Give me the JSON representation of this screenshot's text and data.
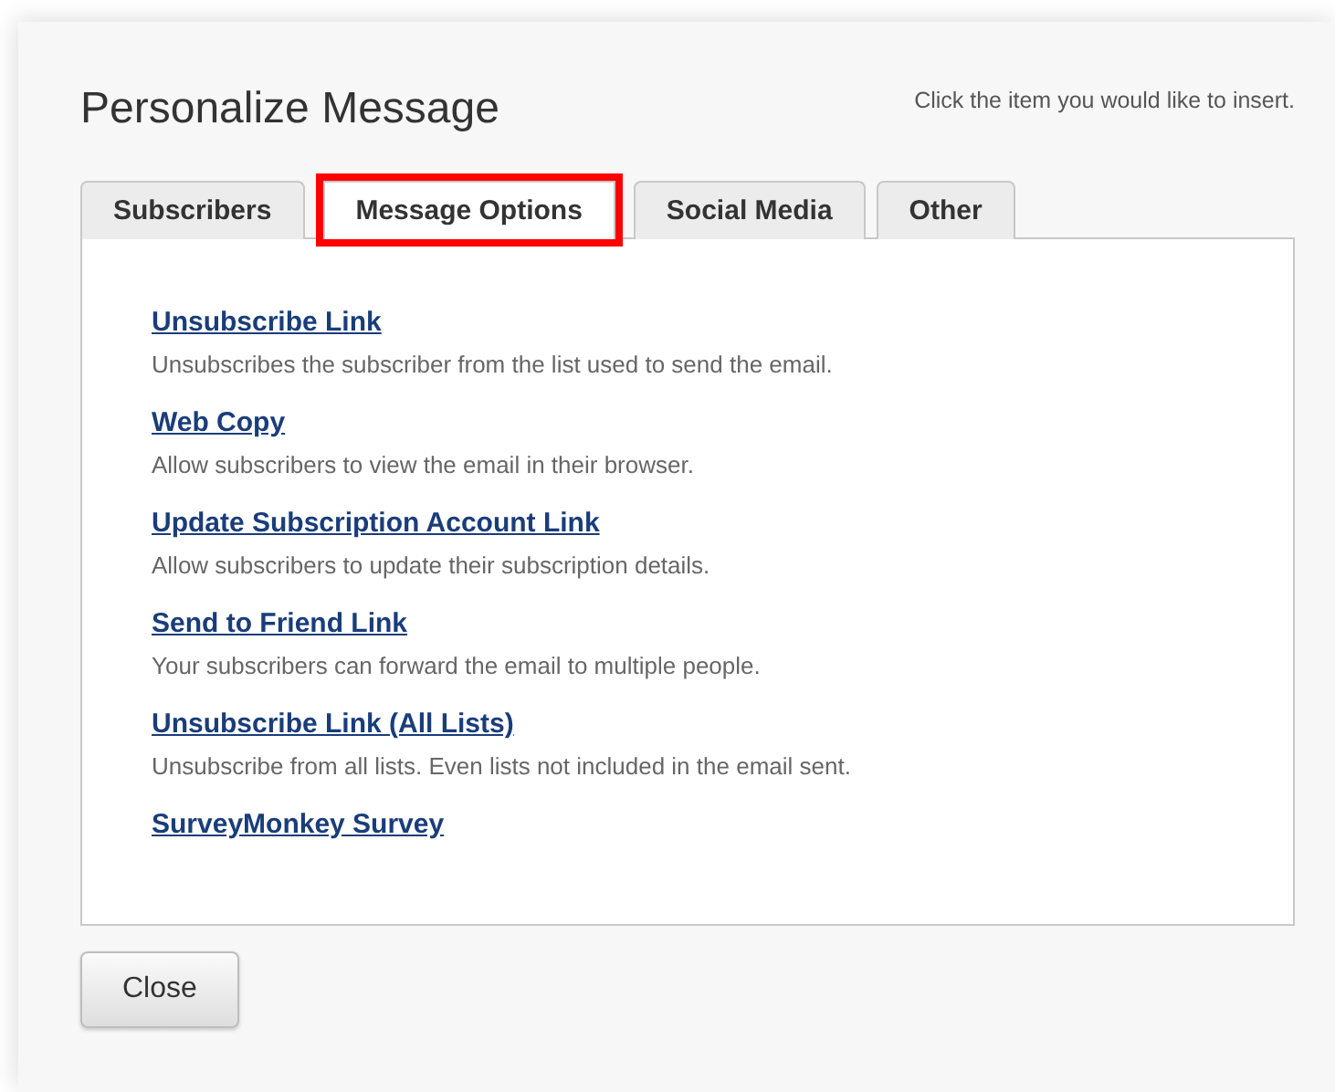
{
  "dialog": {
    "title": "Personalize Message",
    "hint": "Click the item you would like to insert."
  },
  "tabs": [
    {
      "label": "Subscribers",
      "selected": false,
      "highlighted": false
    },
    {
      "label": "Message Options",
      "selected": true,
      "highlighted": true
    },
    {
      "label": "Social Media",
      "selected": false,
      "highlighted": false
    },
    {
      "label": "Other",
      "selected": false,
      "highlighted": false
    }
  ],
  "items": [
    {
      "link": "Unsubscribe Link",
      "description": "Unsubscribes the subscriber from the list used to send the email."
    },
    {
      "link": "Web Copy",
      "description": "Allow subscribers to view the email in their browser."
    },
    {
      "link": "Update Subscription Account Link",
      "description": "Allow subscribers to update their subscription details."
    },
    {
      "link": "Send to Friend Link",
      "description": "Your subscribers can forward the email to multiple people."
    },
    {
      "link": "Unsubscribe Link (All Lists)",
      "description": "Unsubscribe from all lists. Even lists not included in the email sent."
    },
    {
      "link": "SurveyMonkey Survey"
    }
  ],
  "buttons": [
    "Close"
  ]
}
